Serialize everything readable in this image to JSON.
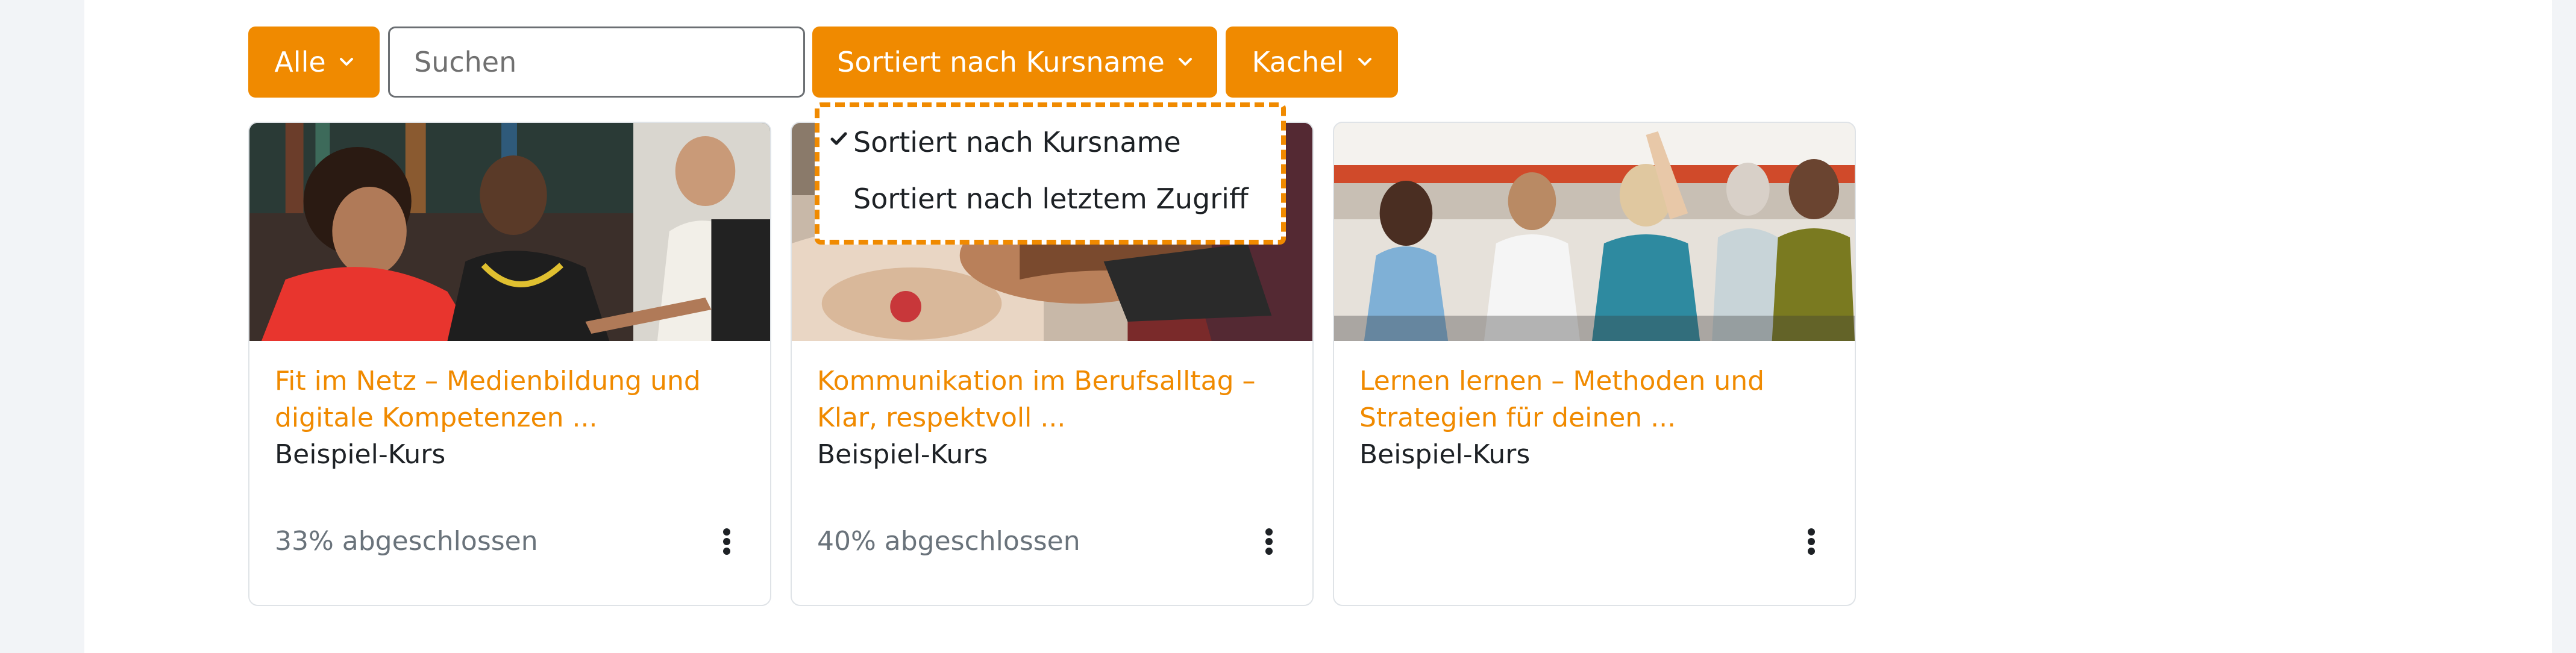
{
  "filters": {
    "grouping_label": "Alle",
    "search_placeholder": "Suchen",
    "sort_label": "Sortiert nach Kursname",
    "view_label": "Kachel"
  },
  "sort_menu": {
    "items": [
      {
        "label": "Sortiert nach Kursname",
        "selected": true
      },
      {
        "label": "Sortiert nach letztem Zugriff",
        "selected": false
      }
    ]
  },
  "courses": [
    {
      "title": "Fit im Netz – Medienbildung und digitale Kompetenzen ...",
      "category": "Beispiel-Kurs",
      "progress": "33% abgeschlossen",
      "image": "students-at-computer-photo"
    },
    {
      "title": "Kommunikation im Berufsalltag – Klar, respektvoll ...",
      "category": "Beispiel-Kurs",
      "progress": "40% abgeschlossen",
      "image": "stacked-hands-teamwork-photo"
    },
    {
      "title": "Lernen lernen – Methoden und Strategien für deinen ...",
      "category": "Beispiel-Kurs",
      "progress": "",
      "image": "seminar-audience-raising-hand-photo"
    }
  ],
  "colors": {
    "accent": "#f08a00",
    "page_bg": "#f2f4f7",
    "panel_bg": "#ffffff",
    "text": "#1d2125",
    "muted": "#6a737b"
  }
}
